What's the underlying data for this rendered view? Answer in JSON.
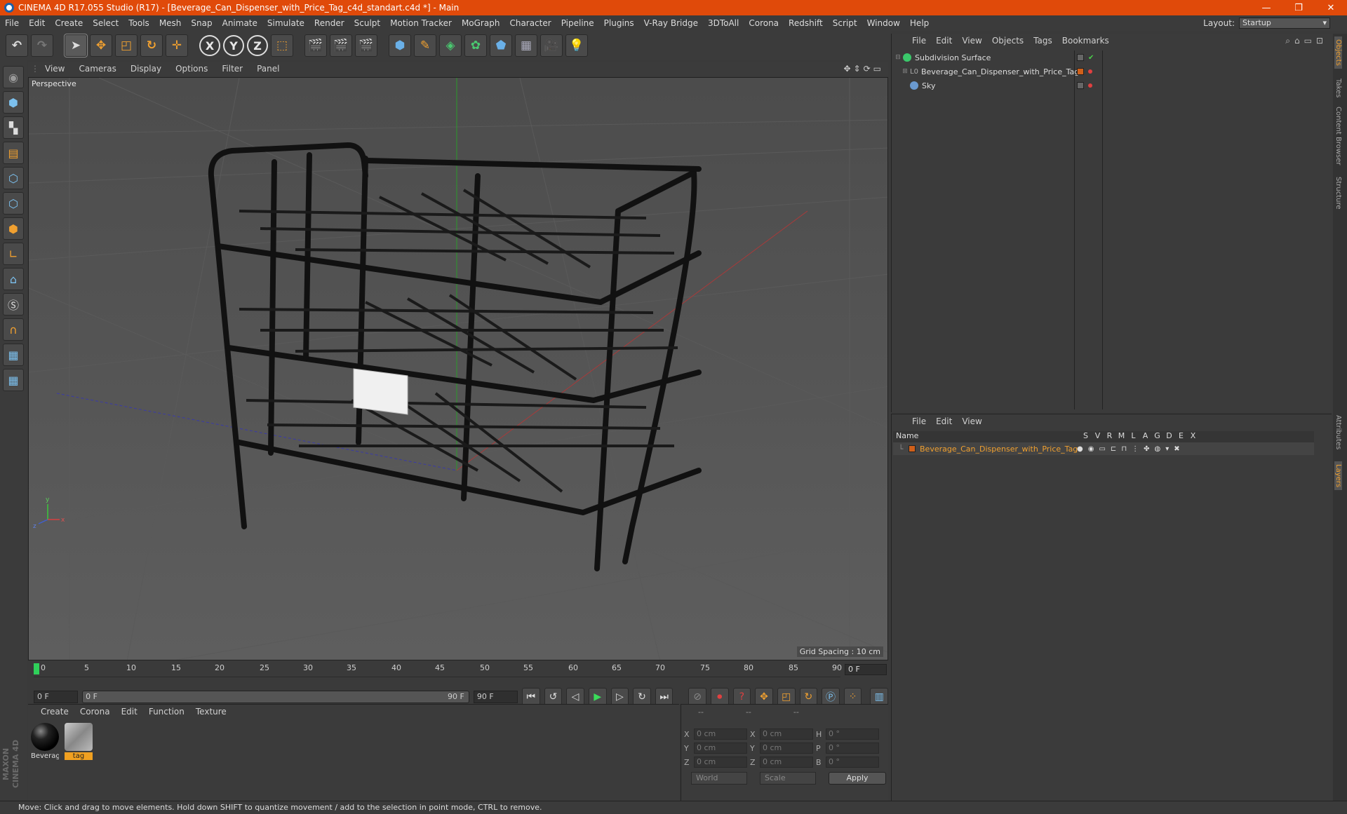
{
  "window": {
    "title": "CINEMA 4D R17.055 Studio (R17) - [Beverage_Can_Dispenser_with_Price_Tag_c4d_standart.c4d *] - Main",
    "minimize": "—",
    "restore": "❐",
    "close": "✕"
  },
  "menubar": {
    "items": [
      "File",
      "Edit",
      "Create",
      "Select",
      "Tools",
      "Mesh",
      "Snap",
      "Animate",
      "Simulate",
      "Render",
      "Sculpt",
      "Motion Tracker",
      "MoGraph",
      "Character",
      "Pipeline",
      "Plugins",
      "V-Ray Bridge",
      "3DToAll",
      "Corona",
      "Redshift",
      "Script",
      "Window",
      "Help"
    ],
    "layout_label": "Layout:",
    "layout_value": "Startup"
  },
  "toolbar": {
    "undo_icon": "undo-icon",
    "axis_x": "X",
    "axis_y": "Y",
    "axis_z": "Z"
  },
  "viewport": {
    "menu": [
      "View",
      "Cameras",
      "Display",
      "Options",
      "Filter",
      "Panel"
    ],
    "label": "Perspective",
    "grid_spacing": "Grid Spacing : 10 cm",
    "axis_x": "x",
    "axis_y": "y",
    "axis_z": "z"
  },
  "timeline": {
    "ticks": [
      "0",
      "5",
      "10",
      "15",
      "20",
      "25",
      "30",
      "35",
      "40",
      "45",
      "50",
      "55",
      "60",
      "65",
      "70",
      "75",
      "80",
      "85",
      "90"
    ],
    "current_frame": "0 F",
    "start_frame": "0 F",
    "range_start": "0 F",
    "range_end": "90 F",
    "end_frame": "90 F"
  },
  "materials": {
    "menu": [
      "Create",
      "Corona",
      "Edit",
      "Function",
      "Texture"
    ],
    "items": [
      {
        "label": "Beverag",
        "selected": false
      },
      {
        "label": "tag",
        "selected": true
      }
    ]
  },
  "coords": {
    "header": [
      "--",
      "--",
      "--"
    ],
    "rows": [
      {
        "a": "X",
        "av": "0 cm",
        "b": "X",
        "bv": "0 cm",
        "c": "H",
        "cv": "0 °"
      },
      {
        "a": "Y",
        "av": "0 cm",
        "b": "Y",
        "bv": "0 cm",
        "c": "P",
        "cv": "0 °"
      },
      {
        "a": "Z",
        "av": "0 cm",
        "b": "Z",
        "bv": "0 cm",
        "c": "B",
        "cv": "0 °"
      }
    ],
    "world": "World",
    "scale": "Scale",
    "apply": "Apply"
  },
  "objects": {
    "menu": [
      "File",
      "Edit",
      "View",
      "Objects",
      "Tags",
      "Bookmarks"
    ],
    "items": [
      {
        "name": "Subdivision Surface",
        "expander": "⊟"
      },
      {
        "name": "Beverage_Can_Dispenser_with_Price_Tag",
        "expander": "⊞"
      },
      {
        "name": "Sky",
        "expander": ""
      }
    ]
  },
  "layers": {
    "menu": [
      "File",
      "Edit",
      "View"
    ],
    "header_name": "Name",
    "columns": [
      "S",
      "V",
      "R",
      "M",
      "L",
      "A",
      "G",
      "D",
      "E",
      "X"
    ],
    "row_name": "Beverage_Can_Dispenser_with_Price_Tag"
  },
  "right_tabs": [
    "Objects",
    "Takes",
    "Content Browser",
    "Structure",
    "Attributes",
    "Layers"
  ],
  "logo": "MAXON CINEMA 4D",
  "status": "Move: Click and drag to move elements. Hold down SHIFT to quantize movement / add to the selection in point mode, CTRL to remove.",
  "colors": {
    "titlebar": "#e04a0a",
    "accent": "#f0a030",
    "selected_label": "#f0a020"
  }
}
